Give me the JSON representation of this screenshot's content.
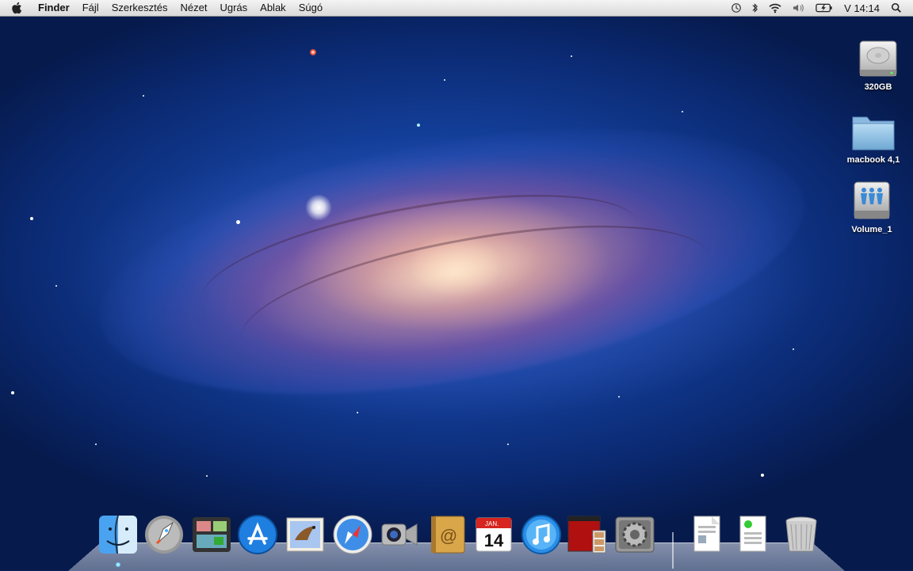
{
  "menubar": {
    "app_name": "Finder",
    "menus": [
      "Fájl",
      "Szerkesztés",
      "Nézet",
      "Ugrás",
      "Ablak",
      "Súgó"
    ],
    "clock": "V 14:14",
    "status_icons": [
      "time-machine-icon",
      "bluetooth-icon",
      "wifi-icon",
      "volume-icon",
      "battery-icon",
      "spotlight-icon"
    ]
  },
  "desktop": {
    "icons": [
      {
        "label": "320GB",
        "icon": "hard-drive-icon"
      },
      {
        "label": "macbook 4,1",
        "icon": "folder-icon"
      },
      {
        "label": "Volume_1",
        "icon": "network-volume-icon"
      }
    ]
  },
  "calendar_icon": {
    "month": "JAN.",
    "day": "14"
  },
  "dock": {
    "items": [
      "finder-icon",
      "launchpad-icon",
      "mission-control-icon",
      "app-store-icon",
      "mail-icon",
      "safari-icon",
      "facetime-icon",
      "address-book-icon",
      "ical-icon",
      "itunes-icon",
      "photo-booth-icon",
      "system-preferences-icon",
      "document-stack-icon",
      "document-stack-icon",
      "trash-icon"
    ]
  },
  "colors": {
    "menubar_bg": "#e6e6e6",
    "wallpaper_deep": "#0b2a73",
    "galaxy_core": "#ffe6c8",
    "folder_blue": "#8fc3e6"
  }
}
